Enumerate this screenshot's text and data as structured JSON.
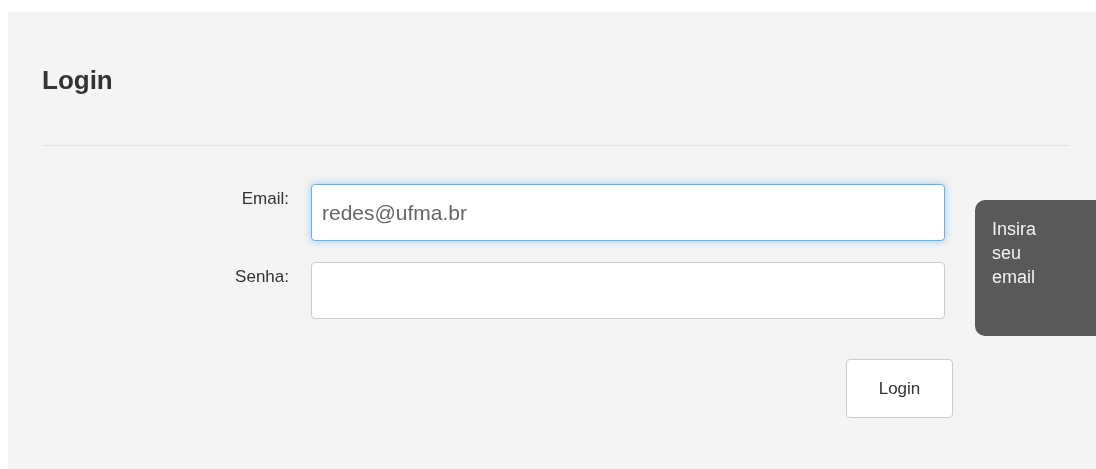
{
  "title": "Login",
  "fields": [
    {
      "label": "Email:",
      "value": "redes@ufma.br",
      "focused": true
    },
    {
      "label": "Senha:",
      "focused": false
    }
  ],
  "tooltip": "Insira seu email",
  "button": "Login"
}
